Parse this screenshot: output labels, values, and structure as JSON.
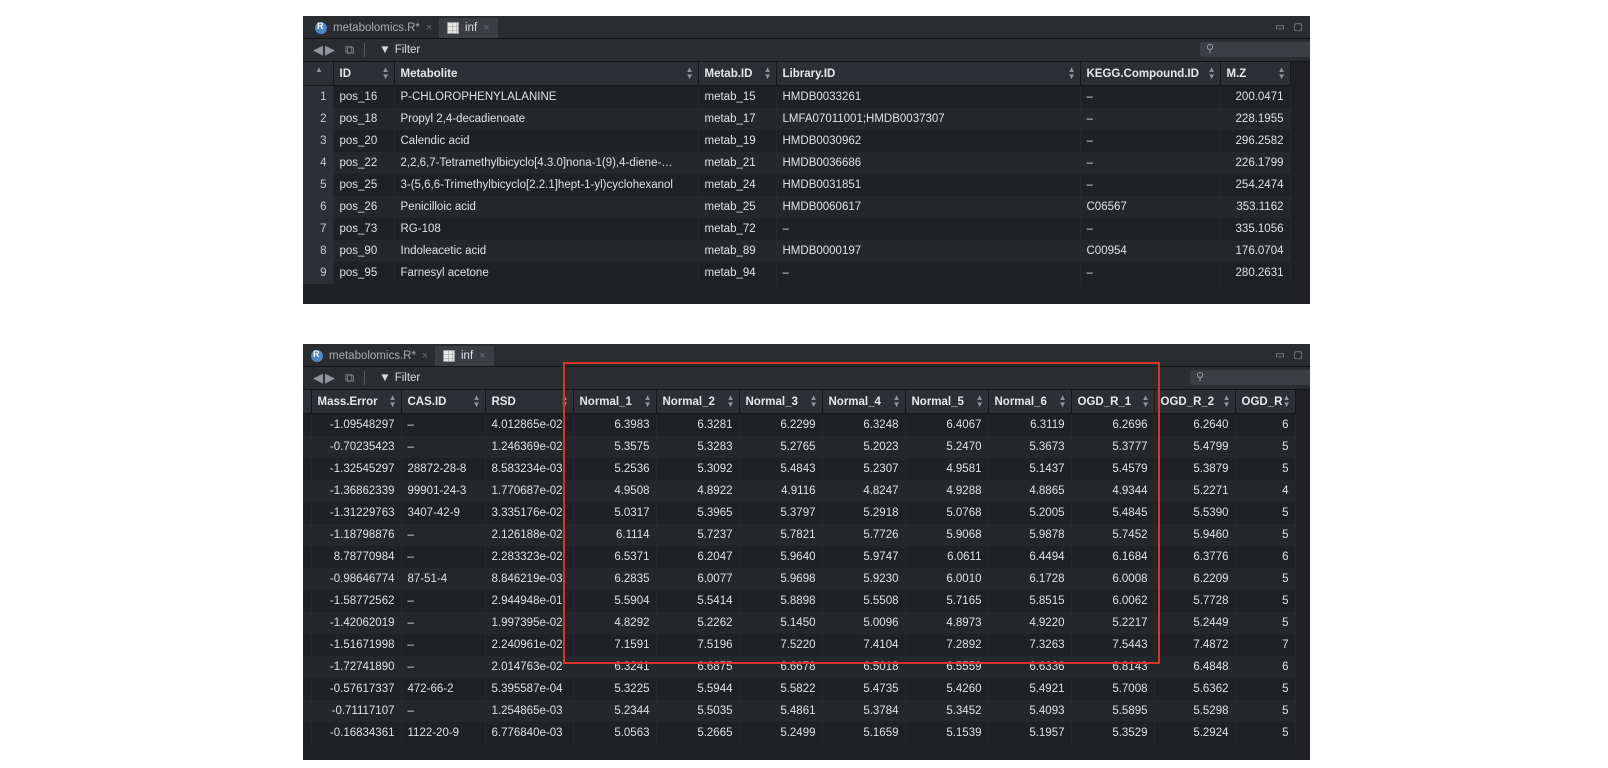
{
  "tabs": {
    "script_tab": "metabolomics.R*",
    "data_tab": "inf",
    "close_glyph": "×"
  },
  "toolbar": {
    "filter_label": "Filter"
  },
  "table1": {
    "columns": [
      "ID",
      "Metabolite",
      "Metab.ID",
      "Library.ID",
      "KEGG.Compound.ID",
      "M.Z"
    ],
    "rows": [
      [
        "1",
        "pos_16",
        "P-CHLOROPHENYLALANINE",
        "metab_15",
        "HMDB0033261",
        "–",
        "200.0471"
      ],
      [
        "2",
        "pos_18",
        "Propyl 2,4-decadienoate",
        "metab_17",
        "LMFA07011001;HMDB0037307",
        "–",
        "228.1955"
      ],
      [
        "3",
        "pos_20",
        "Calendic acid",
        "metab_19",
        "HMDB0030962",
        "–",
        "296.2582"
      ],
      [
        "4",
        "pos_22",
        "2,2,6,7-Tetramethylbicyclo[4.3.0]nona-1(9),4-diene-…",
        "metab_21",
        "HMDB0036686",
        "–",
        "226.1799"
      ],
      [
        "5",
        "pos_25",
        "3-(5,6,6-Trimethylbicyclo[2.2.1]hept-1-yl)cyclohexanol",
        "metab_24",
        "HMDB0031851",
        "–",
        "254.2474"
      ],
      [
        "6",
        "pos_26",
        "Penicilloic acid",
        "metab_25",
        "HMDB0060617",
        "C06567",
        "353.1162"
      ],
      [
        "7",
        "pos_73",
        "RG-108",
        "metab_72",
        "–",
        "–",
        "335.1056"
      ],
      [
        "8",
        "pos_90",
        "Indoleacetic acid",
        "metab_89",
        "HMDB0000197",
        "C00954",
        "176.0704"
      ],
      [
        "9",
        "pos_95",
        "Farnesyl acetone",
        "metab_94",
        "–",
        "–",
        "280.2631"
      ]
    ]
  },
  "table2": {
    "columns": [
      "Mass.Error",
      "CAS.ID",
      "RSD",
      "Normal_1",
      "Normal_2",
      "Normal_3",
      "Normal_4",
      "Normal_5",
      "Normal_6",
      "OGD_R_1",
      "OGD_R_2",
      "OGD_R"
    ],
    "rows": [
      [
        "-1.09548297",
        "–",
        "4.012865e-02",
        "6.3983",
        "6.3281",
        "6.2299",
        "6.3248",
        "6.4067",
        "6.3119",
        "6.2696",
        "6.2640",
        "6"
      ],
      [
        "-0.70235423",
        "–",
        "1.246369e-02",
        "5.3575",
        "5.3283",
        "5.2765",
        "5.2023",
        "5.2470",
        "5.3673",
        "5.3777",
        "5.4799",
        "5"
      ],
      [
        "-1.32545297",
        "28872-28-8",
        "8.583234e-03",
        "5.2536",
        "5.3092",
        "5.4843",
        "5.2307",
        "4.9581",
        "5.1437",
        "5.4579",
        "5.3879",
        "5"
      ],
      [
        "-1.36862339",
        "99901-24-3",
        "1.770687e-02",
        "4.9508",
        "4.8922",
        "4.9116",
        "4.8247",
        "4.9288",
        "4.8865",
        "4.9344",
        "5.2271",
        "4"
      ],
      [
        "-1.31229763",
        "3407-42-9",
        "3.335176e-02",
        "5.0317",
        "5.3965",
        "5.3797",
        "5.2918",
        "5.0768",
        "5.2005",
        "5.4845",
        "5.5390",
        "5"
      ],
      [
        "-1.18798876",
        "–",
        "2.126188e-02",
        "6.1114",
        "5.7237",
        "5.7821",
        "5.7726",
        "5.9068",
        "5.9878",
        "5.7452",
        "5.9460",
        "5"
      ],
      [
        "8.78770984",
        "–",
        "2.283323e-02",
        "6.5371",
        "6.2047",
        "5.9640",
        "5.9747",
        "6.0611",
        "6.4494",
        "6.1684",
        "6.3776",
        "6"
      ],
      [
        "-0.98646774",
        "87-51-4",
        "8.846219e-03",
        "6.2835",
        "6.0077",
        "5.9698",
        "5.9230",
        "6.0010",
        "6.1728",
        "6.0008",
        "6.2209",
        "5"
      ],
      [
        "-1.58772562",
        "–",
        "2.944948e-01",
        "5.5904",
        "5.5414",
        "5.8898",
        "5.5508",
        "5.7165",
        "5.8515",
        "6.0062",
        "5.7728",
        "5"
      ],
      [
        "-1.42062019",
        "–",
        "1.997395e-02",
        "4.8292",
        "5.2262",
        "5.1450",
        "5.0096",
        "4.8973",
        "4.9220",
        "5.2217",
        "5.2449",
        "5"
      ],
      [
        "-1.51671998",
        "–",
        "2.240961e-02",
        "7.1591",
        "7.5196",
        "7.5220",
        "7.4104",
        "7.2892",
        "7.3263",
        "7.5443",
        "7.4872",
        "7"
      ],
      [
        "-1.72741890",
        "–",
        "2.014763e-02",
        "6.3241",
        "6.6875",
        "6.6678",
        "6.5018",
        "6.5559",
        "6.6336",
        "6.8143",
        "6.4848",
        "6"
      ],
      [
        "-0.57617337",
        "472-66-2",
        "5.395587e-04",
        "5.3225",
        "5.5944",
        "5.5822",
        "5.4735",
        "5.4260",
        "5.4921",
        "5.7008",
        "5.6362",
        "5"
      ],
      [
        "-0.71117107",
        "–",
        "1.254865e-03",
        "5.2344",
        "5.5035",
        "5.4861",
        "5.3784",
        "5.3452",
        "5.4093",
        "5.5895",
        "5.5298",
        "5"
      ],
      [
        "-0.16834361",
        "1122-20-9",
        "6.776840e-03",
        "5.0563",
        "5.2665",
        "5.2499",
        "5.1659",
        "5.1539",
        "5.1957",
        "5.3529",
        "5.2924",
        "5"
      ]
    ]
  }
}
